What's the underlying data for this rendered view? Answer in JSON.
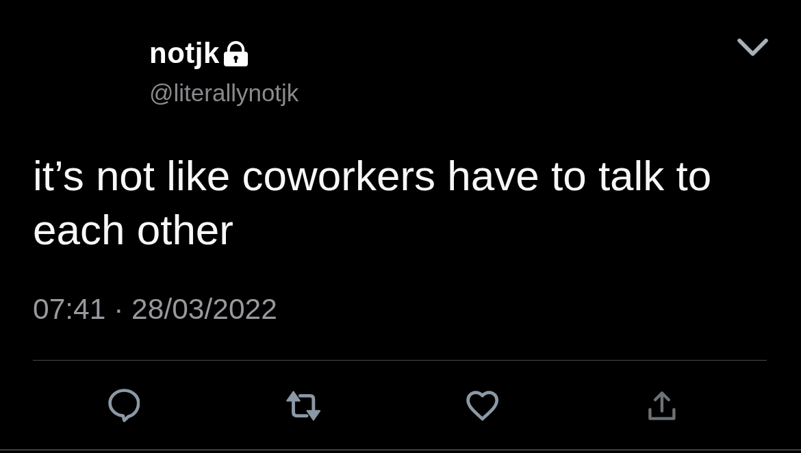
{
  "user": {
    "name": "notjk",
    "protected": true,
    "handle": "@literallynotjk"
  },
  "tweet": {
    "text": "it’s not like coworkers have to talk to each other",
    "timestamp": "07:41 · 28/03/2022"
  },
  "actions": [
    {
      "kind": "reply"
    },
    {
      "kind": "retweet"
    },
    {
      "kind": "like"
    },
    {
      "kind": "share"
    }
  ]
}
